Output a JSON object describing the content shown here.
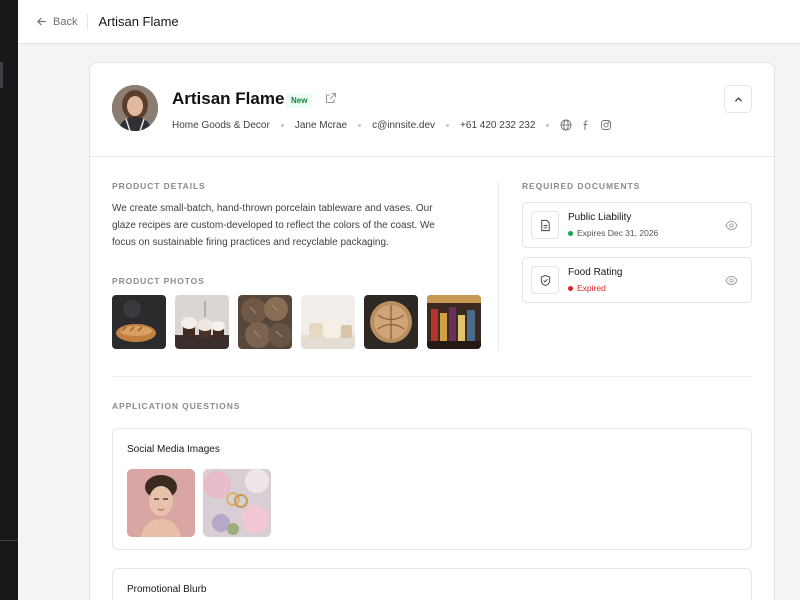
{
  "topbar": {
    "back_label": "Back",
    "title": "Artisan Flame"
  },
  "profile": {
    "name": "Artisan Flame",
    "badge": "New",
    "category": "Home Goods & Decor",
    "contact_name": "Jane Mcrae",
    "email": "c@innsite.dev",
    "phone": "+61 420 232 232",
    "social_icons": [
      "globe-icon",
      "facebook-icon",
      "instagram-icon"
    ]
  },
  "product_details": {
    "label": "PRODUCT DETAILS",
    "text": "We create small-batch, hand-thrown porcelain tableware and vases. Our glaze recipes are custom-developed to reflect the colors of the coast. We focus on sustainable firing practices and recyclable packaging."
  },
  "product_photos": {
    "label": "PRODUCT PHOTOS",
    "items": [
      "bread-loaves",
      "cupcakes",
      "cookies",
      "ceramic-cups",
      "round-bread",
      "bottles"
    ]
  },
  "required_documents": {
    "label": "REQUIRED DOCUMENTS",
    "items": [
      {
        "name": "Public Liability",
        "status": "Expires Dec 31, 2026",
        "status_color": "#16a34a",
        "icon": "document-icon"
      },
      {
        "name": "Food Rating",
        "status": "Expired",
        "status_color": "#dc2626",
        "icon": "shield-check-icon"
      }
    ]
  },
  "application_questions": {
    "label": "APPLICATION QUESTIONS",
    "items": [
      {
        "title": "Social Media Images",
        "images": [
          "portrait",
          "flowers-rings"
        ]
      },
      {
        "title": "Promotional Blurb"
      }
    ]
  },
  "colors": {
    "accent_green": "#15803d",
    "badge_bg": "#ecfdf3",
    "expired_red": "#dc2626",
    "active_green": "#16a34a"
  }
}
